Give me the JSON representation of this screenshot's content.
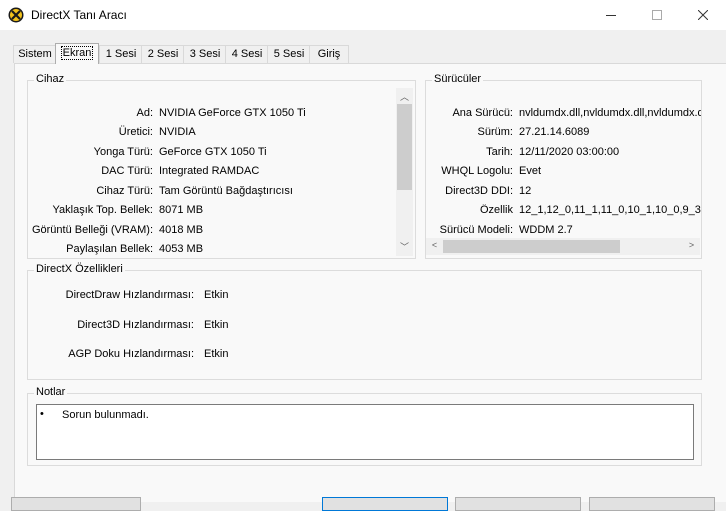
{
  "window": {
    "title": "DirectX Tanı Aracı",
    "icon": "directx-x-icon",
    "controls": [
      "minimize-icon",
      "maximize-icon",
      "close-icon"
    ]
  },
  "tabs": [
    {
      "label": "Sistem",
      "active": false
    },
    {
      "label": "Ekran",
      "active": true
    },
    {
      "label": "1 Sesi",
      "active": false
    },
    {
      "label": "2 Sesi",
      "active": false
    },
    {
      "label": "3 Sesi",
      "active": false
    },
    {
      "label": "4 Sesi",
      "active": false
    },
    {
      "label": "5 Sesi",
      "active": false
    },
    {
      "label": "Giriş",
      "active": false
    }
  ],
  "device": {
    "title": "Cihaz",
    "rows": [
      {
        "label": "Ad:",
        "value": "NVIDIA GeForce GTX 1050 Ti"
      },
      {
        "label": "Üretici:",
        "value": "NVIDIA"
      },
      {
        "label": "Yonga Türü:",
        "value": "GeForce GTX 1050 Ti"
      },
      {
        "label": "DAC Türü:",
        "value": "Integrated RAMDAC"
      },
      {
        "label": "Cihaz Türü:",
        "value": "Tam Görüntü Bağdaştırıcısı"
      },
      {
        "label": "Yaklaşık Top. Bellek:",
        "value": "8071 MB"
      },
      {
        "label": "Görüntü Belleği (VRAM):",
        "value": "4018 MB"
      },
      {
        "label": "Paylaşılan Bellek:",
        "value": "4053 MB"
      }
    ]
  },
  "drivers": {
    "title": "Sürücüler",
    "rows": [
      {
        "label": "Ana Sürücü:",
        "value": "nvldumdx.dll,nvldumdx.dll,nvldumdx.d"
      },
      {
        "label": "Sürüm:",
        "value": "27.21.14.6089"
      },
      {
        "label": "Tarih:",
        "value": "12/11/2020 03:00:00"
      },
      {
        "label": "WHQL Logolu:",
        "value": "Evet"
      },
      {
        "label": "Direct3D DDI:",
        "value": "12"
      },
      {
        "label": "Özellik",
        "value": "12_1,12_0,11_1,11_0,10_1,10_0,9_3"
      },
      {
        "label": "Sürücü Modeli:",
        "value": "WDDM 2.7"
      }
    ]
  },
  "features": {
    "title": "DirectX Özellikleri",
    "rows": [
      {
        "label": "DirectDraw Hızlandırması:",
        "value": "Etkin"
      },
      {
        "label": "Direct3D Hızlandırması:",
        "value": "Etkin"
      },
      {
        "label": "AGP Doku Hızlandırması:",
        "value": "Etkin"
      }
    ]
  },
  "notes": {
    "title": "Notlar",
    "bullet": "•",
    "text": "Sorun bulunmadı."
  }
}
